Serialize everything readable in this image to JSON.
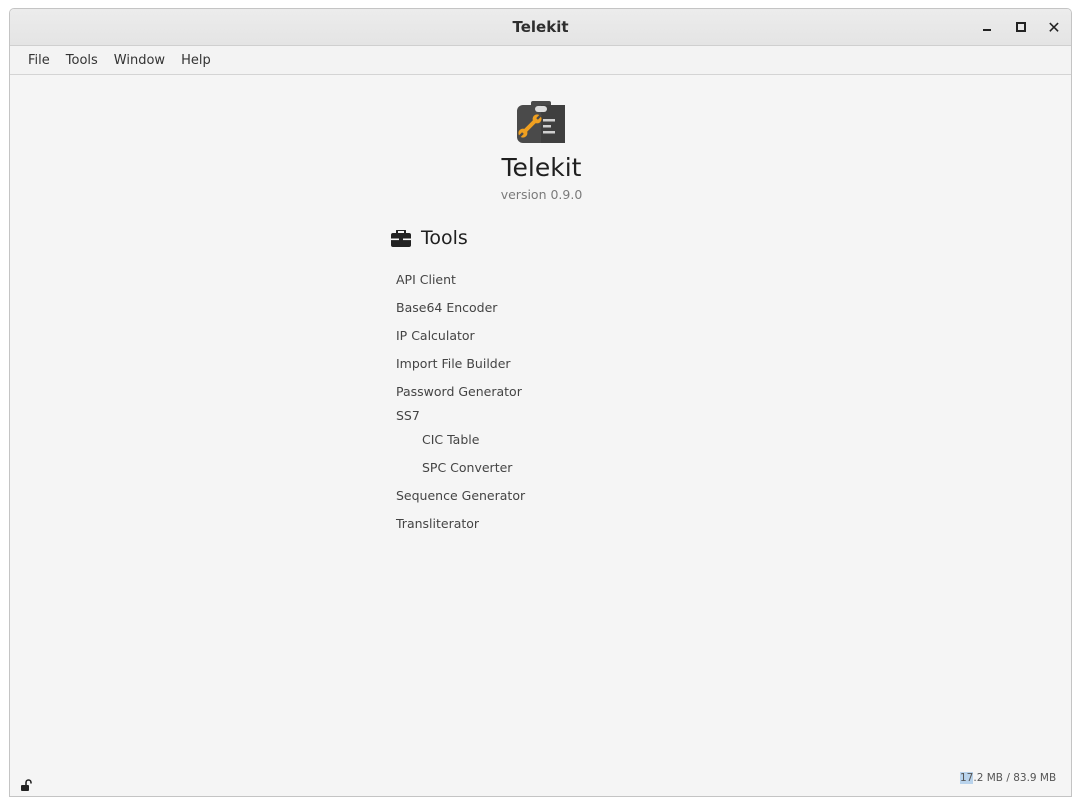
{
  "window": {
    "title": "Telekit",
    "controls": {
      "minimize": "minimize",
      "maximize": "maximize",
      "close": "✕"
    }
  },
  "menubar": {
    "items": [
      "File",
      "Tools",
      "Window",
      "Help"
    ]
  },
  "about": {
    "app_name": "Telekit",
    "version": "version 0.9.0"
  },
  "tools": {
    "header": "Tools",
    "items": [
      {
        "label": "API Client",
        "indent": 0
      },
      {
        "label": "Base64 Encoder",
        "indent": 0
      },
      {
        "label": "IP Calculator",
        "indent": 0
      },
      {
        "label": "Import File Builder",
        "indent": 0
      },
      {
        "label": "Password Generator",
        "indent": 0
      },
      {
        "label": "SS7",
        "indent": 0
      },
      {
        "label": "CIC Table",
        "indent": 1
      },
      {
        "label": "SPC Converter",
        "indent": 1
      },
      {
        "label": "Sequence Generator",
        "indent": 0
      },
      {
        "label": "Transliterator",
        "indent": 0
      }
    ]
  },
  "statusbar": {
    "lock_icon": "unlock-icon",
    "memory_used": "17.2 MB",
    "memory_sep": " / ",
    "memory_total": "83.9 MB"
  },
  "colors": {
    "logo_bg": "#4a4a4a",
    "logo_accent": "#f0a020"
  }
}
